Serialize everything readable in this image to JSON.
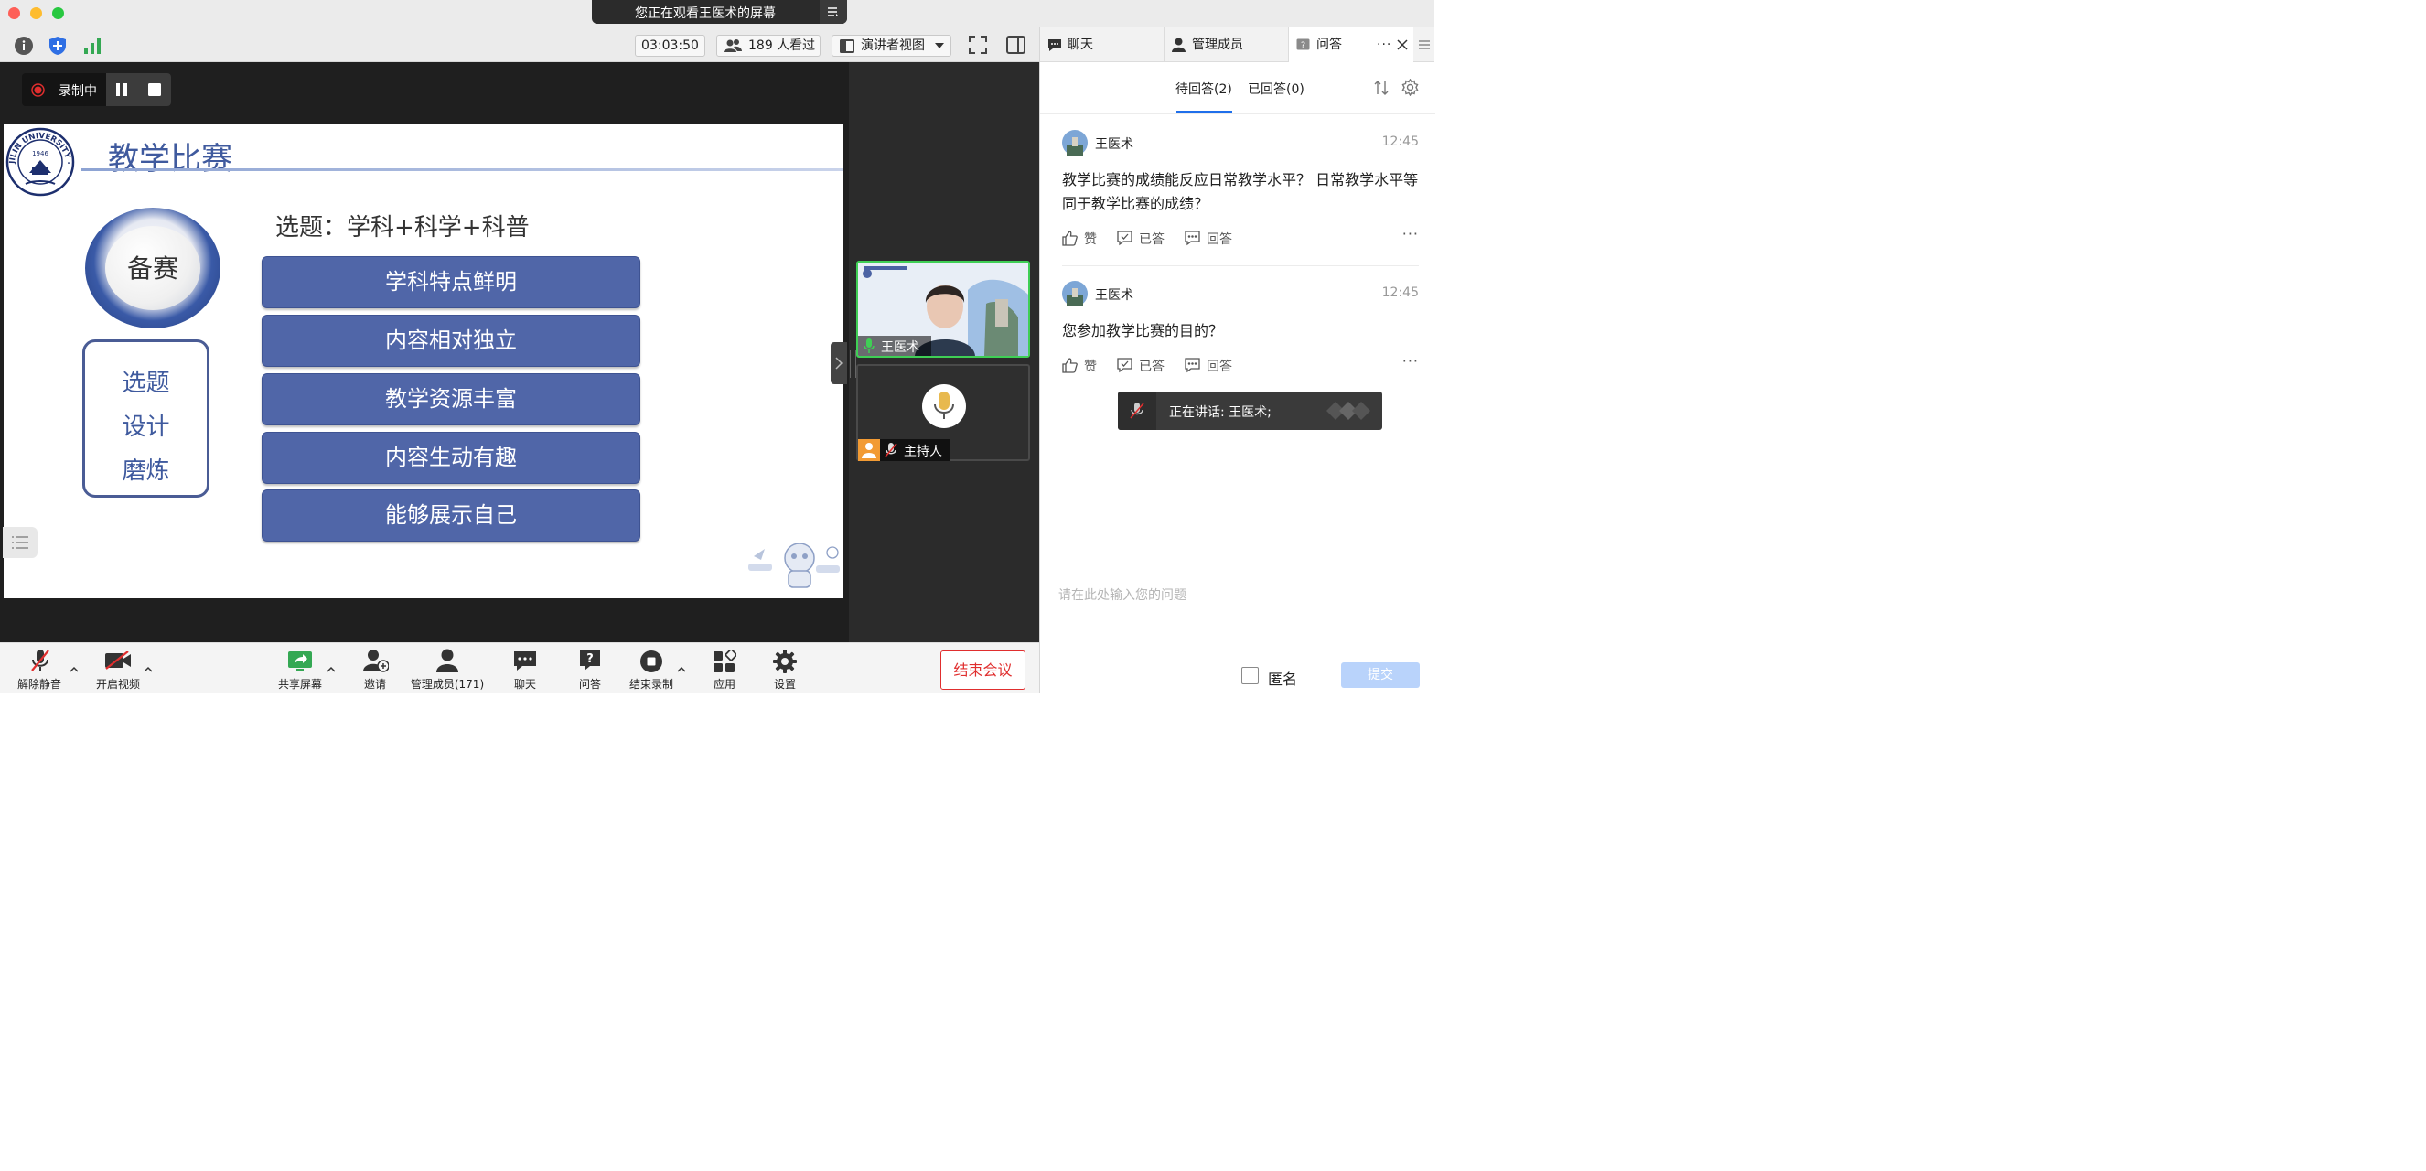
{
  "window": {
    "share_banner": "您正在观看王医术的屏幕"
  },
  "toolbar": {
    "timer": "03:03:50",
    "viewers": "189 人看过",
    "view_mode": "演讲者视图"
  },
  "right_tabs": [
    {
      "label": "聊天",
      "icon": "chat-icon"
    },
    {
      "label": "管理成员",
      "icon": "members-icon"
    },
    {
      "label": "问答",
      "icon": "question-icon"
    }
  ],
  "recording": {
    "status": "录制中"
  },
  "slide": {
    "title": "教学比赛",
    "badge": "备赛",
    "steps": [
      "选题",
      "设计",
      "磨炼"
    ],
    "topic_heading": "选题：学科+科学+科普",
    "items": [
      "学科特点鲜明",
      "内容相对独立",
      "教学资源丰富",
      "内容生动有趣",
      "能够展示自己"
    ],
    "logo_text": "JILIN UNIVERSITY · CHINA",
    "logo_year": "1946"
  },
  "gallery": {
    "speaker_name": "王医术",
    "host_label": "主持人"
  },
  "bottom_bar": {
    "unmute": "解除静音",
    "start_video": "开启视频",
    "share_screen": "共享屏幕",
    "invite": "邀请",
    "manage_members": "管理成员(171)",
    "chat": "聊天",
    "qa": "问答",
    "end_recording": "结束录制",
    "apps": "应用",
    "settings": "设置",
    "end_meeting": "结束会议"
  },
  "qa": {
    "tabs": [
      "待回答(2)",
      "已回答(0)"
    ],
    "active_tab": 0,
    "questions": [
      {
        "author": "王医术",
        "time": "12:45",
        "text": "教学比赛的成绩能反应日常教学水平？ 日常教学水平等同于教学比赛的成绩？",
        "actions": [
          "赞",
          "已答",
          "回答"
        ]
      },
      {
        "author": "王医术",
        "time": "12:45",
        "text": "您参加教学比赛的目的？",
        "actions": [
          "赞",
          "已答",
          "回答"
        ]
      }
    ],
    "speaking_toast": "正在讲话: 王医术;",
    "input_placeholder": "请在此处输入您的问题",
    "anonymous_label": "匿名",
    "submit_label": "提交"
  },
  "colors": {
    "accent_blue": "#1f6feb",
    "end_red": "#e02e2e",
    "item_blue": "#5066a8",
    "green": "#34c759"
  }
}
